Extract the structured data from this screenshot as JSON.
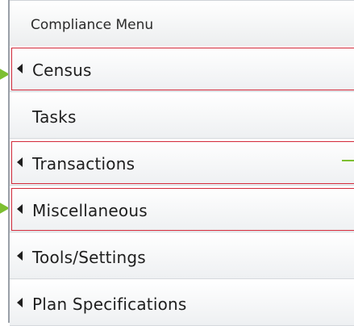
{
  "menu": {
    "title": "Compliance Menu",
    "items": [
      {
        "label": "Census",
        "has_arrow": true
      },
      {
        "label": "Tasks",
        "has_arrow": false
      },
      {
        "label": "Transactions",
        "has_arrow": true
      },
      {
        "label": "Miscellaneous",
        "has_arrow": true
      },
      {
        "label": "Tools/Settings",
        "has_arrow": true
      },
      {
        "label": "Plan Specifications",
        "has_arrow": true
      }
    ]
  },
  "colors": {
    "highlight_border": "#d32a3a",
    "callout_arrow": "#7dbf31",
    "text": "#1e1e1e"
  }
}
